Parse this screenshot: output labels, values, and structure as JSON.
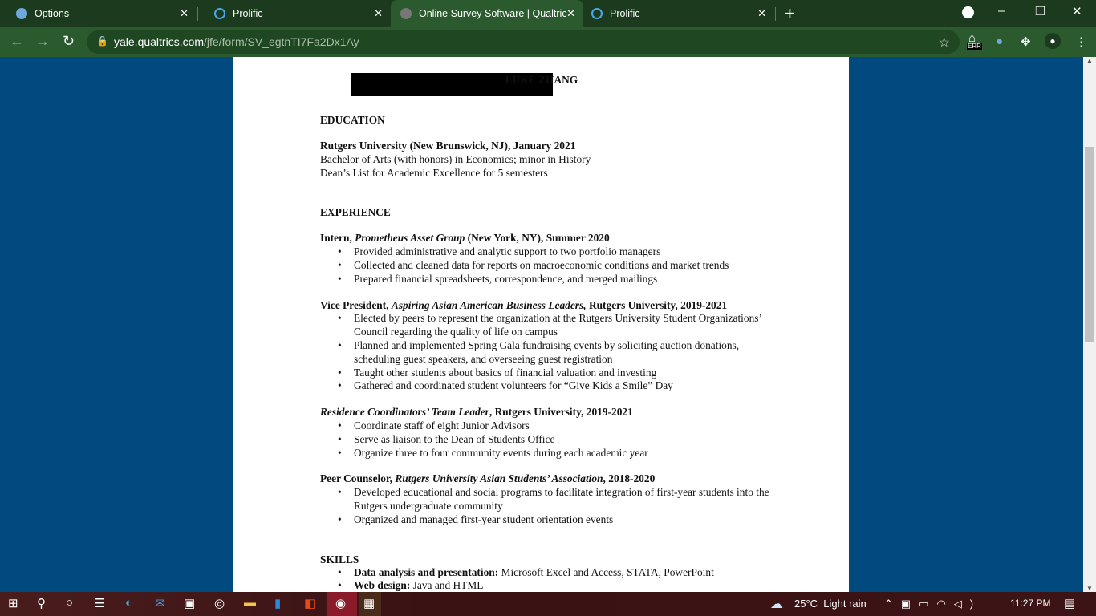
{
  "browser": {
    "tabs": [
      {
        "title": "Options",
        "active": false
      },
      {
        "title": "Prolific",
        "active": false
      },
      {
        "title": "Online Survey Software | Qualtric",
        "active": true
      },
      {
        "title": "Prolific",
        "active": false
      }
    ],
    "url_host": "yale.qualtrics.com",
    "url_path": "/jfe/form/SV_egtnTI7Fa2Dx1Ay",
    "ext_badge": "ERR"
  },
  "resume": {
    "name": "LUKE ZHANG",
    "education": {
      "heading": "EDUCATION",
      "school": "Rutgers University (New Brunswick, NJ), January 2021",
      "degree": "Bachelor of Arts (with honors) in Economics; minor in History",
      "honor": "Dean’s List for Academic Excellence for 5 semesters"
    },
    "experience": {
      "heading": "EXPERIENCE",
      "jobs": [
        {
          "pre": "Intern, ",
          "italic": "Prometheus Asset Group",
          "post": " (New York, NY), Summer 2020",
          "bullets": [
            "Provided administrative and analytic support to two portfolio managers",
            "Collected and cleaned data for reports on macroeconomic conditions and market trends",
            "Prepared financial spreadsheets, correspondence, and merged mailings"
          ]
        },
        {
          "pre": "Vice President, ",
          "italic": "Aspiring Asian American Business Leaders,",
          "post": " Rutgers University, 2019-2021",
          "bullets": [
            "Elected by peers to represent the organization at the Rutgers University Student Organizations’ Council regarding the quality of life on campus",
            "Planned and implemented Spring Gala fundraising events by soliciting auction donations, scheduling guest speakers, and overseeing guest registration",
            "Taught other students about basics of financial valuation and investing",
            "Gathered and coordinated student volunteers for “Give Kids a Smile” Day"
          ]
        },
        {
          "pre": "",
          "italic": "Residence Coordinators’ Team Leader",
          "post": ", Rutgers University, 2019-2021",
          "bullets": [
            "Coordinate staff of eight Junior Advisors",
            "Serve as liaison to the Dean of Students Office",
            "Organize three to four community events during each academic year"
          ]
        },
        {
          "pre": "Peer Counselor, ",
          "italic": "Rutgers University Asian Students’ Association",
          "post": ", 2018-2020",
          "bullets": [
            "Developed educational and social programs to facilitate integration of first-year students into the Rutgers undergraduate community",
            "Organized and managed first-year student orientation events"
          ]
        }
      ]
    },
    "skills": {
      "heading": "SKILLS",
      "items": [
        {
          "label": "Data analysis and presentation:",
          "value": " Microsoft Excel and Access, STATA, PowerPoint"
        },
        {
          "label": "Web design:",
          "value": " Java and HTML"
        }
      ]
    }
  },
  "taskbar": {
    "weather": "25°C  Light rain",
    "time": "11:27 PM"
  }
}
